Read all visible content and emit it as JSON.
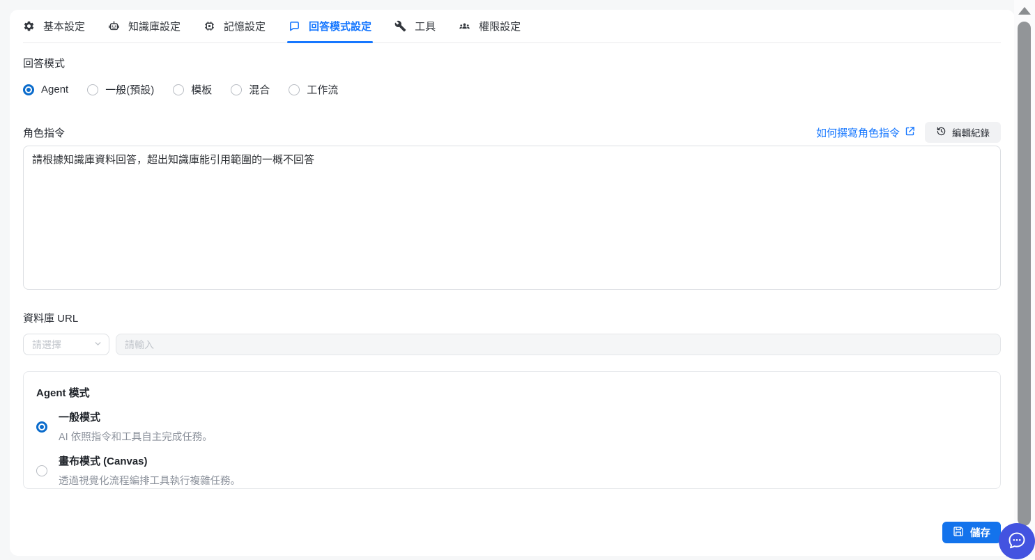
{
  "colors": {
    "accent": "#1677ff",
    "save_button": "#1373ec",
    "radio_selected": "#0b6ccc",
    "chat_fab": "#4353e0"
  },
  "tabs": {
    "items": [
      {
        "label": "基本設定",
        "icon": "gear-icon",
        "active": false
      },
      {
        "label": "知識庫設定",
        "icon": "robot-icon",
        "active": false
      },
      {
        "label": "記憶設定",
        "icon": "chip-icon",
        "active": false
      },
      {
        "label": "回答模式設定",
        "icon": "chat-bubble-icon",
        "active": true
      },
      {
        "label": "工具",
        "icon": "wrench-icon",
        "active": false
      },
      {
        "label": "權限設定",
        "icon": "users-icon",
        "active": false
      }
    ]
  },
  "answer_mode": {
    "label": "回答模式",
    "options": [
      {
        "label": "Agent",
        "selected": true
      },
      {
        "label": "一般(預設)",
        "selected": false
      },
      {
        "label": "模板",
        "selected": false
      },
      {
        "label": "混合",
        "selected": false
      },
      {
        "label": "工作流",
        "selected": false
      }
    ]
  },
  "role_instructions": {
    "label": "角色指令",
    "help_link_label": "如何撰寫角色指令",
    "help_link_icon": "external-link-icon",
    "edit_history_label": "編輯紀錄",
    "edit_history_icon": "history-icon",
    "value": "請根據知識庫資料回答，超出知識庫能引用範圍的一概不回答"
  },
  "database_url": {
    "label": "資料庫 URL",
    "select_placeholder": "請選擇",
    "select_icon": "chevron-down-icon",
    "input_placeholder": "請輸入",
    "input_value": ""
  },
  "agent_mode": {
    "title": "Agent 模式",
    "options": [
      {
        "label": "一般模式",
        "description": "AI 依照指令和工具自主完成任務。",
        "selected": true
      },
      {
        "label": "畫布模式 (Canvas)",
        "description": "透過視覺化流程編排工具執行複雜任務。",
        "selected": false
      }
    ]
  },
  "footer": {
    "save_label": "儲存",
    "save_icon": "save-icon",
    "chat_icon": "chat-dots-icon"
  }
}
